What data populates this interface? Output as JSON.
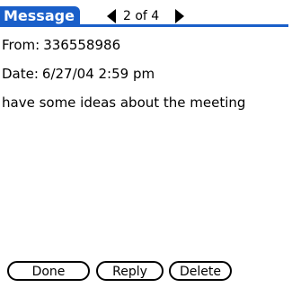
{
  "header": {
    "title": "Message",
    "counter": "2 of 4"
  },
  "fields": {
    "from_label": "From:",
    "from_value": "336558986",
    "date_label": "Date:",
    "date_value": "6/27/04 2:59 pm"
  },
  "message": {
    "body": "have some ideas about the meeting"
  },
  "buttons": {
    "done": "Done",
    "reply": "Reply",
    "delete": "Delete"
  },
  "colors": {
    "accent": "#1a5fc9"
  }
}
